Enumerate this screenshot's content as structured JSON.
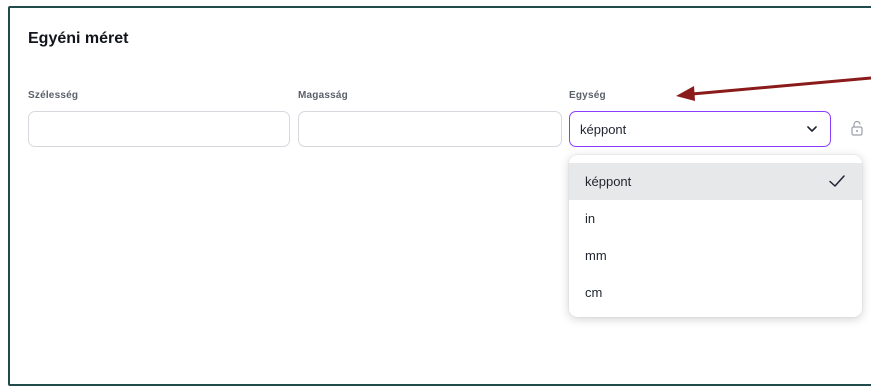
{
  "dialog": {
    "title": "Egyéni méret",
    "width_label": "Szélesség",
    "height_label": "Magasság",
    "unit_label": "Egység",
    "width_value": "",
    "height_value": "",
    "unit_selected": "képpont"
  },
  "unit_menu": {
    "options": [
      "képpont",
      "in",
      "mm",
      "cm"
    ],
    "selected_index": 0
  },
  "colors": {
    "frame_border": "#1f4b4a",
    "select_focus_border": "#8b3dff",
    "annotation_arrow": "#8b1a1a",
    "selected_option_bg": "#e7e8ea"
  },
  "icons": {
    "dropdown": "chevron-down-icon",
    "lock": "lock-icon",
    "check": "check-icon"
  }
}
